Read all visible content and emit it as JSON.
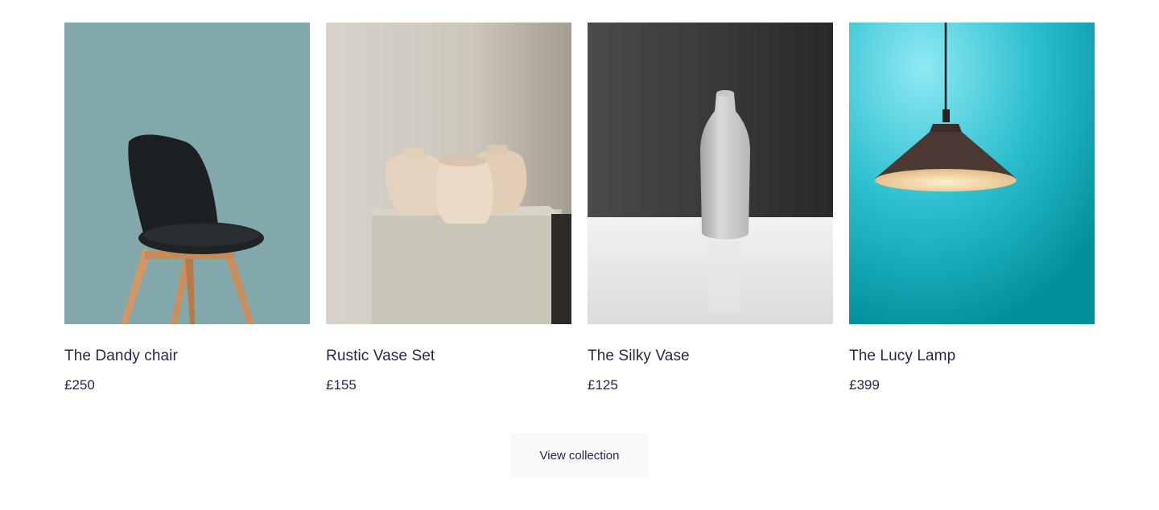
{
  "products": [
    {
      "name": "The Dandy chair",
      "price": "£250"
    },
    {
      "name": "Rustic Vase Set",
      "price": "£155"
    },
    {
      "name": "The Silky Vase",
      "price": "£125"
    },
    {
      "name": "The Lucy Lamp",
      "price": "£399"
    }
  ],
  "cta": {
    "label": "View collection"
  },
  "colors": {
    "text": "#2a254b",
    "button_bg": "#f9f9f9",
    "chair_bg": "#83a8ab",
    "lamp_bg": "#1fb4c4"
  }
}
